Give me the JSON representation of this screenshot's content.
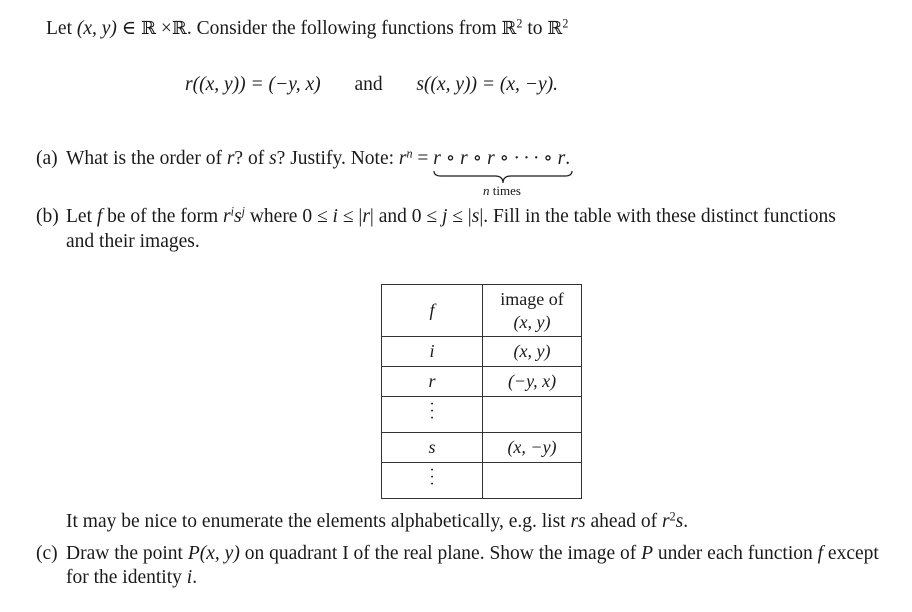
{
  "intro": {
    "let": "Let",
    "pair": "(x, y)",
    "in": "∈",
    "R1": "ℝ",
    "times": "×",
    "R2": "ℝ",
    "rest": ". Consider the following functions from",
    "R3": "ℝ",
    "exp1": "2",
    "to": "to",
    "R4": "ℝ",
    "exp2": "2"
  },
  "equations": {
    "r_def_lhs": "r",
    "r_def_arg": "((x, y))",
    "r_def_rhs": "= (−y, x)",
    "and": "and",
    "s_def_lhs": "s",
    "s_def_arg": "((x, y))",
    "s_def_rhs": "= (x, −y)."
  },
  "part_a": {
    "label": "(a)",
    "text": "What is the order of",
    "r": "r",
    "q1": "? of",
    "s": "s",
    "q2": "? Justify. Note:",
    "rn_base": "r",
    "rn_exp": "n",
    "eq": "=",
    "composition": "r ∘ r ∘ r ∘ · · · ∘ r",
    "period": ".",
    "brace_label_n": "n",
    "brace_label_rest": " times"
  },
  "part_b": {
    "label": "(b)",
    "t1": "Let",
    "f": "f",
    "t2": "be of the form",
    "form_r": "r",
    "form_i": "i",
    "form_s": "s",
    "form_j": "j",
    "t3": "where 0 ≤",
    "i": "i",
    "t4": "≤ |",
    "r": "r",
    "t5": "| and 0 ≤",
    "j": "j",
    "t6": "≤ |",
    "s": "s",
    "t7": "|. Fill in the table with these distinct functions",
    "line2": "and their images."
  },
  "table": {
    "header_f": "f",
    "header_image_line1": "image of",
    "header_image_line2": "(x, y)",
    "rows": [
      {
        "f": "i",
        "image": "(x, y)"
      },
      {
        "f": "r",
        "image": "(−y, x)"
      },
      {
        "f": "⋮",
        "image": ""
      },
      {
        "f": "s",
        "image": "(x, −y)"
      },
      {
        "f": "⋮",
        "image": ""
      }
    ]
  },
  "hint": {
    "t1": "It may be nice to enumerate the elements alphabetically, e.g. list",
    "rs": "rs",
    "t2": "ahead of",
    "r2s_base": "r",
    "r2s_exp": "2",
    "r2s_s": "s",
    "t3": "."
  },
  "part_c": {
    "label": "(c)",
    "t1": "Draw the point",
    "P": "P",
    "pair": "(x, y)",
    "t2": "on quadrant I of the real plane. Show the image of",
    "P2": "P",
    "t3": "under each function",
    "f": "f",
    "t4": "except",
    "line2_t": "for the identity",
    "i": "i",
    "line2_end": "."
  }
}
